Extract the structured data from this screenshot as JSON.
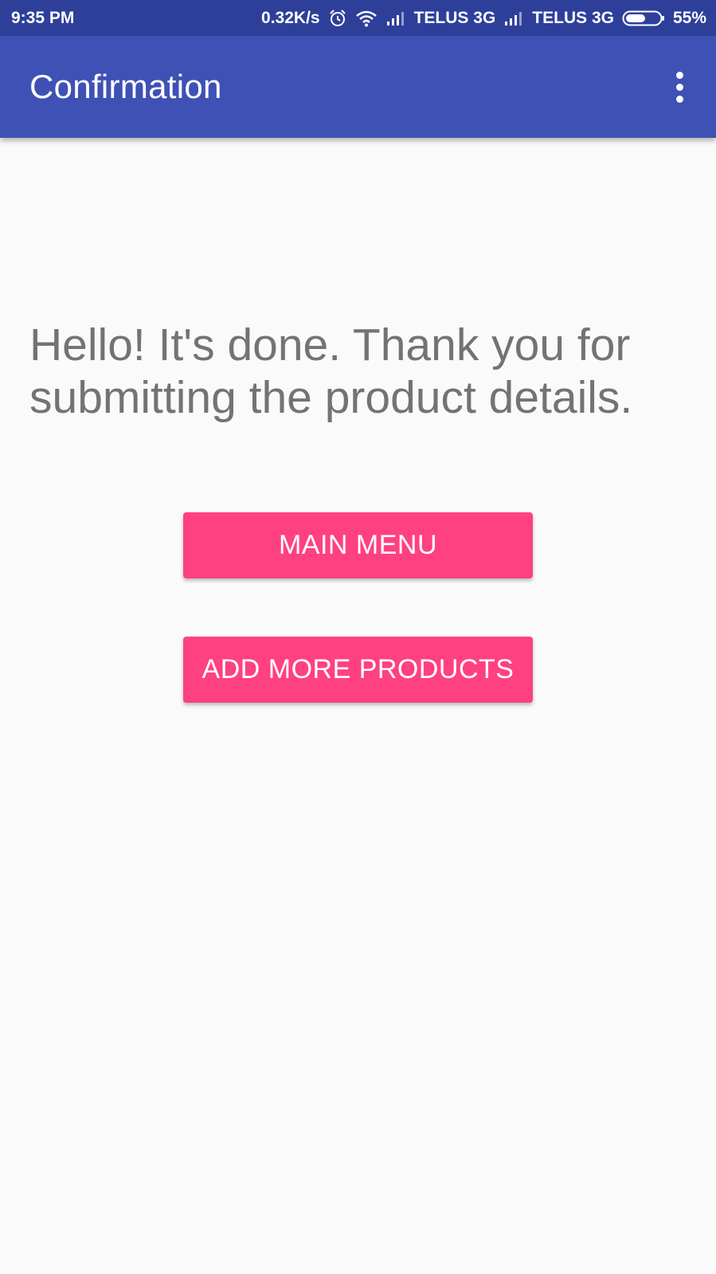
{
  "status_bar": {
    "time": "9:35 PM",
    "net_speed": "0.32K/s",
    "carrier_1": "TELUS 3G",
    "carrier_2": "TELUS 3G",
    "battery": "55%",
    "battery_level": 0.55,
    "icons": [
      "alarm-icon",
      "wifi-icon",
      "signal-icon",
      "signal-icon",
      "battery-icon"
    ]
  },
  "app_bar": {
    "title": "Confirmation",
    "menu_icon": "more-vert-icon"
  },
  "main": {
    "message": "Hello! It's done. Thank you for submitting the product details.",
    "main_menu_label": "MAIN MENU",
    "add_more_label": "ADD MORE PRODUCTS"
  },
  "colors": {
    "status_bar": "#2e3f9a",
    "app_bar": "#3f51b5",
    "accent": "#ff4081",
    "background": "#fafafa",
    "message_text": "#737373"
  }
}
